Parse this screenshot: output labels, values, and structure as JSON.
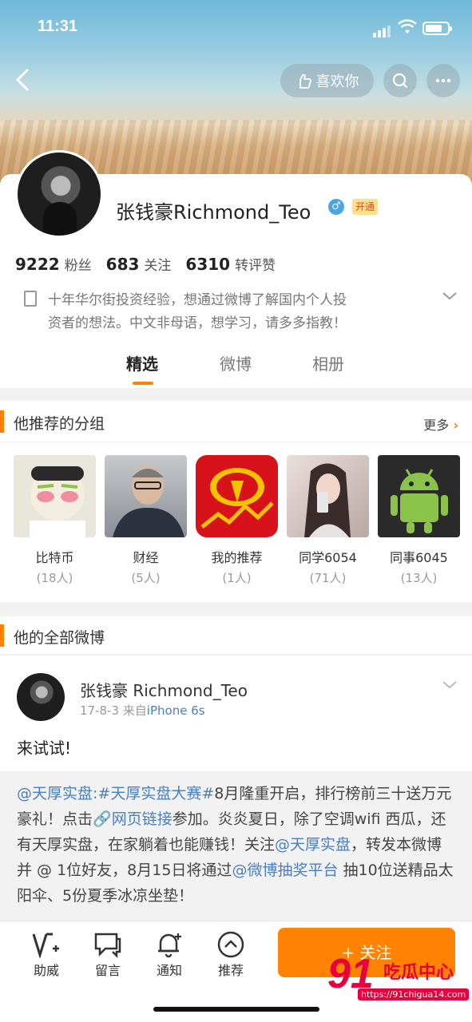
{
  "status": {
    "time": "11:31"
  },
  "header": {
    "like_label": "喜欢你"
  },
  "profile": {
    "name": "张钱豪Richmond_Teo",
    "gender_symbol": "♂",
    "vip_label": "开通",
    "stats": [
      {
        "value": "9222",
        "label": "粉丝"
      },
      {
        "value": "683",
        "label": "关注"
      },
      {
        "value": "6310",
        "label": "转评赞"
      }
    ],
    "bio_line1": "十年华尔街投资经验，想通过微博了解国内个人投",
    "bio_line2": "资者的想法。中文非母语，想学习，请多多指教！"
  },
  "tabs": [
    "精选",
    "微博",
    "相册"
  ],
  "groups": {
    "title": "他推荐的分组",
    "more_label": "更多",
    "items": [
      {
        "name": "比特币",
        "count": "(18人)"
      },
      {
        "name": "财经",
        "count": "(5人)"
      },
      {
        "name": "我的推荐",
        "count": "(1人)"
      },
      {
        "name": "同学6054",
        "count": "(71人)"
      },
      {
        "name": "同事6045",
        "count": "(13人)"
      }
    ]
  },
  "all_weibo": {
    "title": "他的全部微博"
  },
  "post": {
    "author": "张钱豪 Richmond_Teo",
    "date": "17-8-3",
    "from_label": "来自",
    "source": "iPhone 6s",
    "text": "来试试!",
    "repost": {
      "mention1": "@天厚实盘",
      "topic": ":#天厚实盘大赛#",
      "text1": "8月隆重开启，排行榜前三十送万元豪礼！点击",
      "link": "网页链接",
      "text2": "参加。炎炎夏日，除了空调wifi 西瓜，还有天厚实盘，在家躺着也能赚钱！关注",
      "mention2": "@天厚实盘",
      "text3": "，转发本微博并 @ 1位好友，8月15日将通过",
      "mention3": "@微博抽奖平台",
      "text4": " 抽10位送精品太阳伞、5份夏季冰凉坐垫！"
    }
  },
  "toolbar": {
    "items": [
      "助威",
      "留言",
      "通知",
      "推荐"
    ],
    "follow_label": "+ 关注"
  },
  "watermark": {
    "num": "91",
    "text": "吃瓜中心",
    "url": "https://91chigua14.com"
  }
}
